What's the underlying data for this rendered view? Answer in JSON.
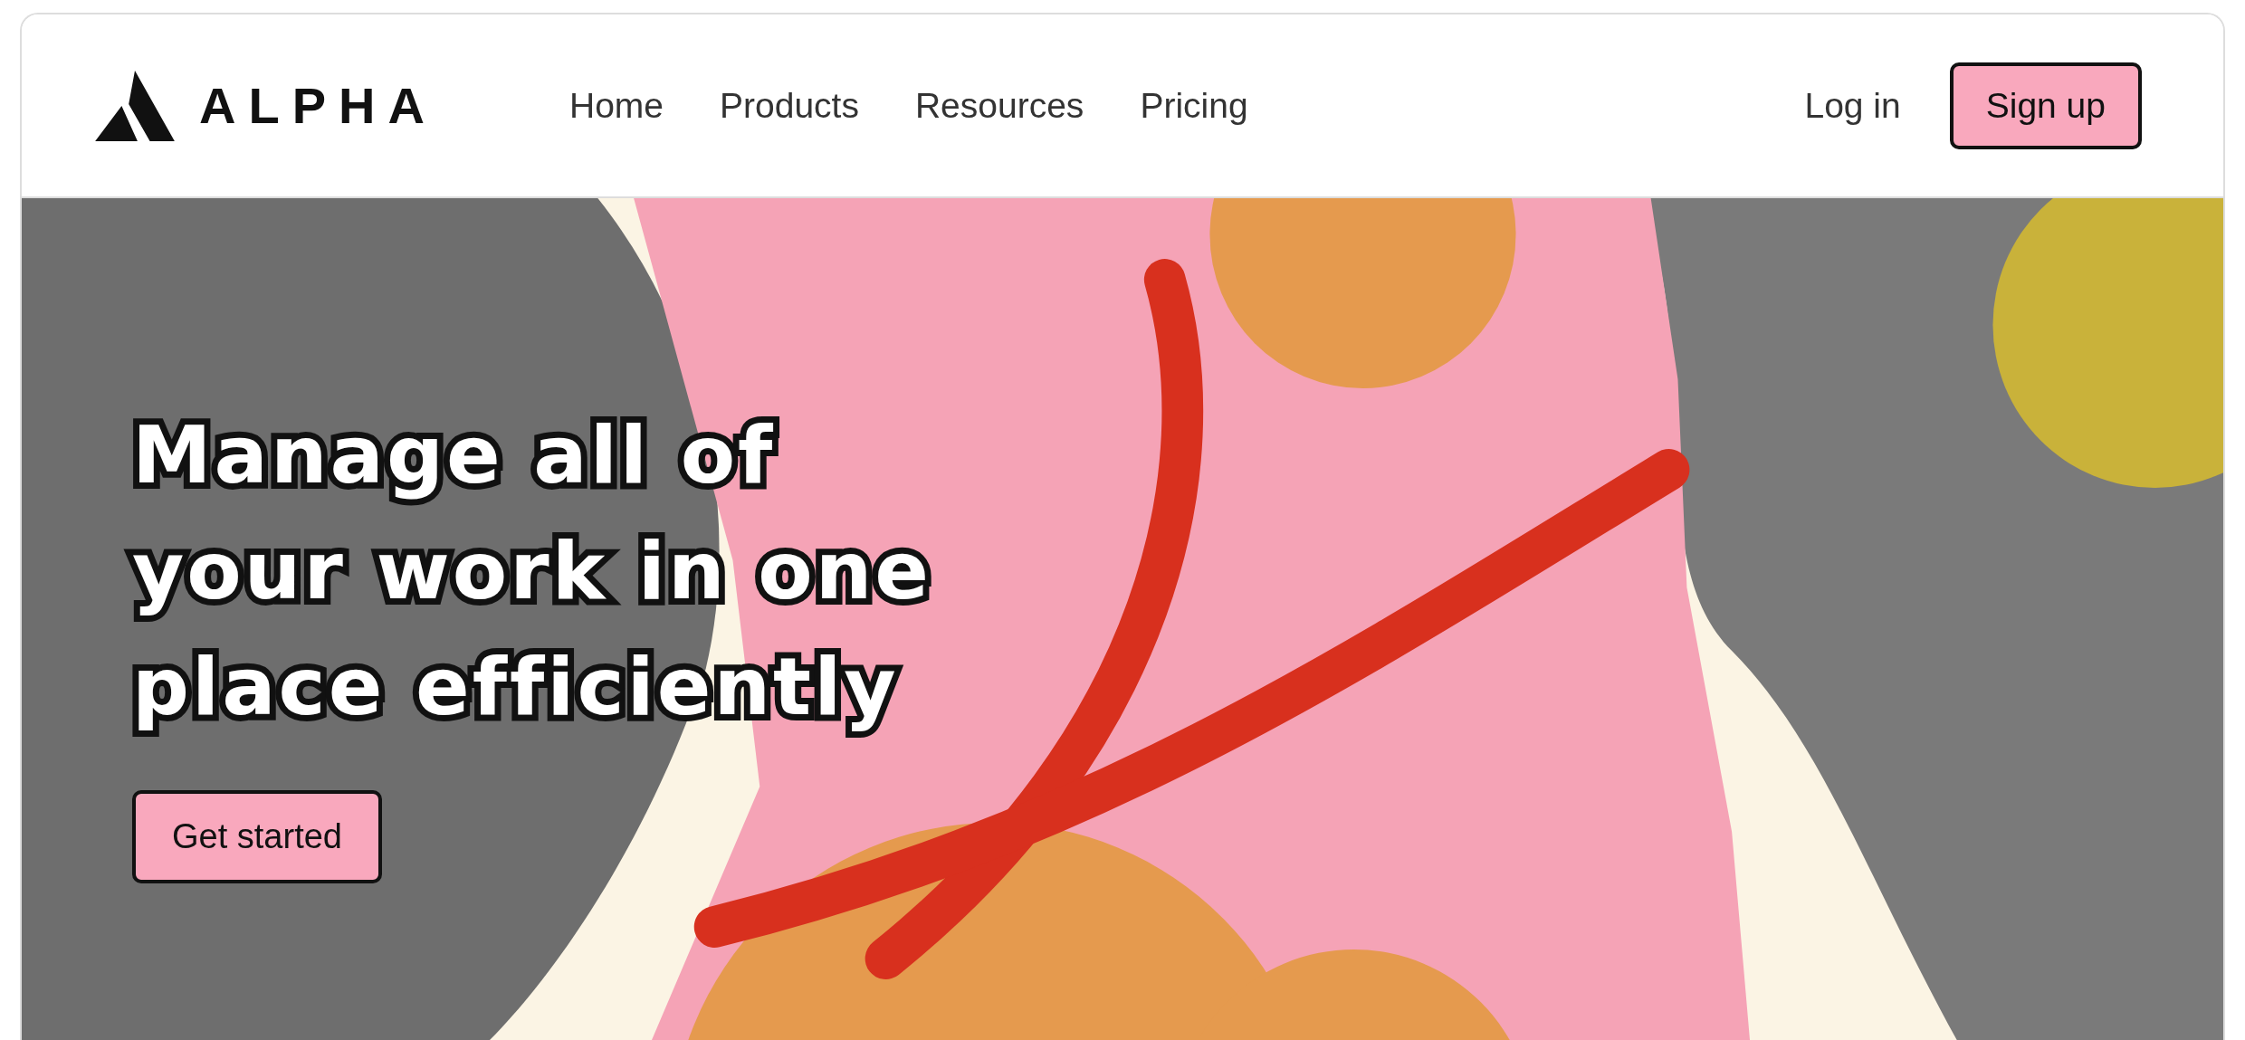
{
  "brand": {
    "name": "ALPHA"
  },
  "nav": {
    "links": [
      "Home",
      "Products",
      "Resources",
      "Pricing"
    ]
  },
  "auth": {
    "login": "Log in",
    "signup": "Sign up"
  },
  "hero": {
    "heading": "Manage all of your work in one place efficiently",
    "cta": "Get started"
  }
}
